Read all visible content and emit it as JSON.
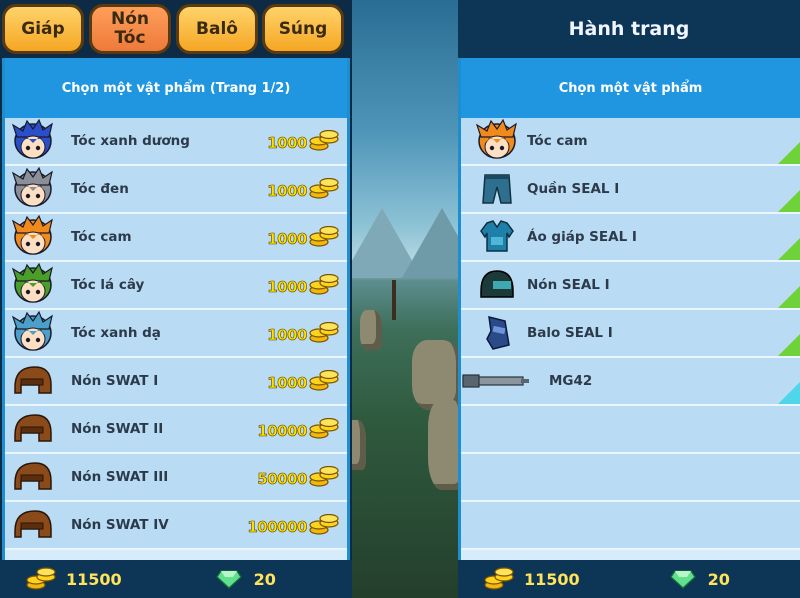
{
  "tabs": [
    {
      "label_1": "Giáp",
      "label_2": "",
      "active": false
    },
    {
      "label_1": "Nón",
      "label_2": "Tóc",
      "active": true
    },
    {
      "label_1": "Balô",
      "label_2": "",
      "active": false
    },
    {
      "label_1": "Súng",
      "label_2": "",
      "active": false
    }
  ],
  "shop": {
    "header": "Chọn một vật phẩm (Trang 1/2)",
    "items": [
      {
        "name": "Tóc xanh dương",
        "price": "1000",
        "icon": "blue-hair-icon",
        "color": "#2a4fc8"
      },
      {
        "name": "Tóc đen",
        "price": "1000",
        "icon": "gray-hair-icon",
        "color": "#8a8f98"
      },
      {
        "name": "Tóc cam",
        "price": "1000",
        "icon": "orange-hair-icon",
        "color": "#f08a1c"
      },
      {
        "name": "Tóc lá cây",
        "price": "1000",
        "icon": "green-hair-icon",
        "color": "#4a9e2a"
      },
      {
        "name": "Tóc xanh dạ",
        "price": "1000",
        "icon": "cyan-hair-icon",
        "color": "#4b9fc8"
      },
      {
        "name": "Nón SWAT I",
        "price": "1000",
        "icon": "swat-helmet-icon",
        "color": "#8a4a1a"
      },
      {
        "name": "Nón SWAT II",
        "price": "10000",
        "icon": "swat-helmet-icon",
        "color": "#8a4a1a"
      },
      {
        "name": "Nón SWAT III",
        "price": "50000",
        "icon": "swat-helmet-icon",
        "color": "#8a4a1a"
      },
      {
        "name": "Nón SWAT IV",
        "price": "100000",
        "icon": "swat-helmet-icon",
        "color": "#8a4a1a"
      }
    ]
  },
  "inventory": {
    "title": "Hành trang",
    "header": "Chọn một vật phẩm",
    "items": [
      {
        "name": "Tóc cam",
        "icon": "orange-hair-icon",
        "color": "#f08a1c",
        "corner": "green"
      },
      {
        "name": "Quần SEAL I",
        "icon": "pants-icon",
        "color": "#2e6e8e",
        "corner": "green"
      },
      {
        "name": "Áo giáp SEAL I",
        "icon": "armor-icon",
        "color": "#1e7fa8",
        "corner": "green"
      },
      {
        "name": "Nón SEAL I",
        "icon": "seal-helmet-icon",
        "color": "#1c3a3a",
        "corner": "green"
      },
      {
        "name": "Balo SEAL I",
        "icon": "backpack-icon",
        "color": "#2a4a8a",
        "corner": "green"
      },
      {
        "name": "MG42",
        "icon": "gun-icon",
        "color": "#8a95a0",
        "corner": "cyan"
      }
    ]
  },
  "wallet": {
    "gold": "11500",
    "gems": "20"
  },
  "colors": {
    "panel_header": "#2196e0",
    "row_bg": "#b9dcf4",
    "price_text": "#ffe000",
    "tab_orange": "#f5a623"
  }
}
